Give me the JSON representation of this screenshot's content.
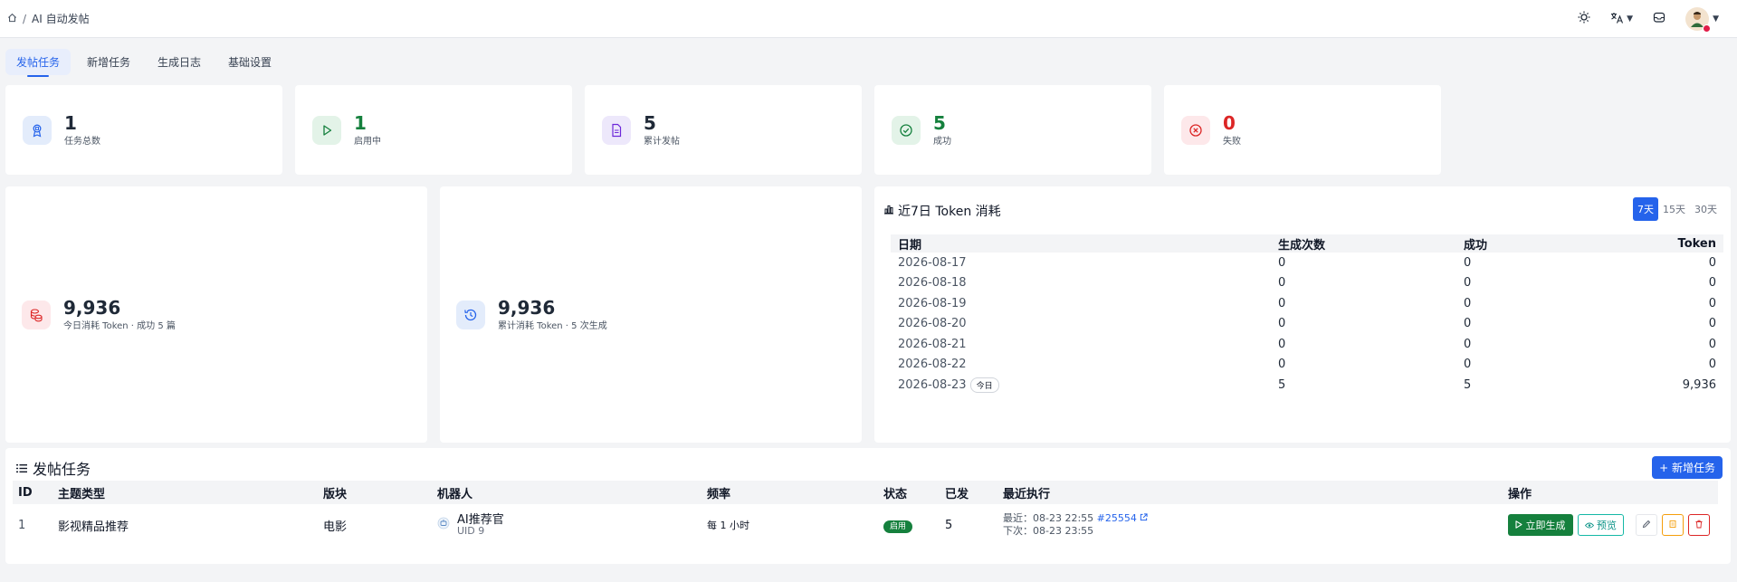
{
  "breadcrumb": {
    "current": "AI 自动发帖"
  },
  "tabs": [
    {
      "label": "发帖任务",
      "active": true
    },
    {
      "label": "新增任务",
      "active": false
    },
    {
      "label": "生成日志",
      "active": false
    },
    {
      "label": "基础设置",
      "active": false
    }
  ],
  "stats": [
    {
      "value": "1",
      "label": "任务总数",
      "color": "#111827"
    },
    {
      "value": "1",
      "label": "启用中",
      "color": "#15803d"
    },
    {
      "value": "5",
      "label": "累计发帖",
      "color": "#111827"
    },
    {
      "value": "5",
      "label": "成功",
      "color": "#15803d"
    },
    {
      "value": "0",
      "label": "失败",
      "color": "#dc2626"
    }
  ],
  "token_today": {
    "value": "9,936",
    "label": "今日消耗 Token · 成功 5 篇"
  },
  "token_total": {
    "value": "9,936",
    "label": "累计消耗 Token · 5 次生成"
  },
  "token_panel": {
    "title": "近7日 Token 消耗",
    "ranges": [
      "7天",
      "15天",
      "30天"
    ],
    "selected_range": "7天",
    "headers": {
      "date": "日期",
      "count": "生成次数",
      "success": "成功",
      "token": "Token"
    },
    "today_badge": "今日",
    "rows": [
      {
        "date": "2026-08-17",
        "count": "0",
        "success": "0",
        "token": "0"
      },
      {
        "date": "2026-08-18",
        "count": "0",
        "success": "0",
        "token": "0"
      },
      {
        "date": "2026-08-19",
        "count": "0",
        "success": "0",
        "token": "0"
      },
      {
        "date": "2026-08-20",
        "count": "0",
        "success": "0",
        "token": "0"
      },
      {
        "date": "2026-08-21",
        "count": "0",
        "success": "0",
        "token": "0"
      },
      {
        "date": "2026-08-22",
        "count": "0",
        "success": "0",
        "token": "0"
      },
      {
        "date": "2026-08-23",
        "count": "5",
        "success": "5",
        "token": "9,936"
      }
    ]
  },
  "tasks": {
    "title": "发帖任务",
    "add_label": "+ 新增任务",
    "headers": {
      "id": "ID",
      "topic": "主题类型",
      "board": "版块",
      "bot": "机器人",
      "freq": "频率",
      "status": "状态",
      "posted": "已发",
      "last": "最近执行",
      "ops": "操作"
    },
    "rows": [
      {
        "id": "1",
        "topic": "影视精品推荐",
        "board": "电影",
        "bot_name": "AI推荐官",
        "bot_uid": "UID 9",
        "freq": "每 1 小时",
        "status": "启用",
        "posted": "5",
        "last_label": "最近：",
        "last_time": "08-23 22:55",
        "last_link": "#25554",
        "next_label": "下次：",
        "next_time": "08-23 23:55",
        "gen_label": "立即生成",
        "preview_label": "预览"
      }
    ]
  }
}
